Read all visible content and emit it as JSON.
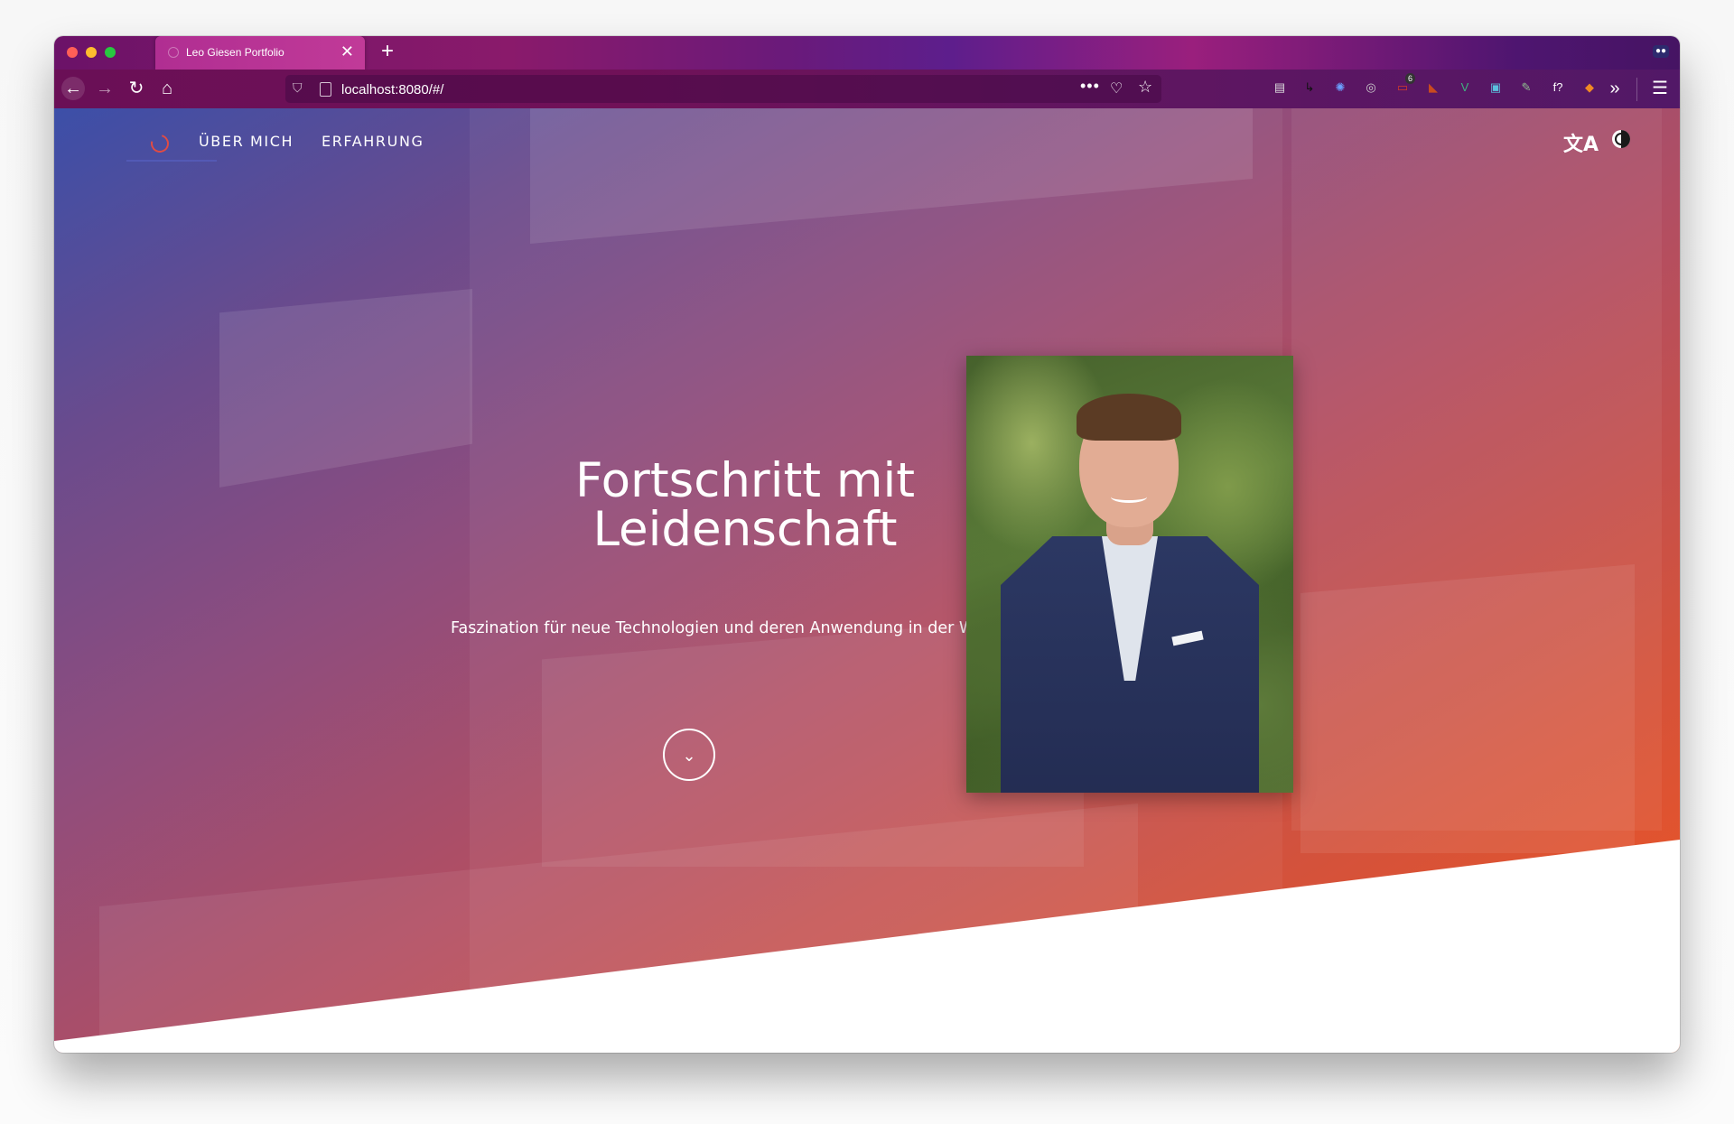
{
  "browser": {
    "tab_title": "Leo Giesen Portfolio",
    "tab_close": "✕",
    "new_tab": "+",
    "url": "localhost:8080/#/",
    "url_more": "•••",
    "nav": {
      "back": "←",
      "forward": "→",
      "reload": "↻",
      "home": "⌂"
    },
    "extensions": [
      {
        "name": "extension-1",
        "glyph": "▤",
        "color": "#dddddd"
      },
      {
        "name": "extension-2",
        "glyph": "↳",
        "color": "#111111"
      },
      {
        "name": "extension-3",
        "glyph": "✺",
        "color": "#6ba0ff"
      },
      {
        "name": "extension-4",
        "glyph": "◎",
        "color": "#cfcfcf"
      },
      {
        "name": "extension-5",
        "glyph": "▭",
        "color": "#d53a2a",
        "badge": "6"
      },
      {
        "name": "extension-6",
        "glyph": "◣",
        "color": "#c94b1f"
      },
      {
        "name": "extension-7",
        "glyph": "V",
        "color": "#3fb27f"
      },
      {
        "name": "extension-8",
        "glyph": "▣",
        "color": "#5bc0de"
      },
      {
        "name": "extension-9",
        "glyph": "✎",
        "color": "#8fbf8f"
      },
      {
        "name": "extension-10",
        "glyph": "f?",
        "color": "#ffffff"
      },
      {
        "name": "extension-11",
        "glyph": "◆",
        "color": "#f08a24"
      }
    ],
    "overflow": "»",
    "menu": "☰"
  },
  "site": {
    "nav_links": [
      "ÜBER MICH",
      "ERFAHRUNG"
    ],
    "hero_title_line1": "Fortschritt mit",
    "hero_title_line2": "Leidenschaft",
    "hero_subtitle": "Faszination für neue Technologien und deren Anwendung in der Wirtschaft",
    "scroll_icon": "⌄",
    "translate_icon": "文A"
  },
  "colors": {
    "gradient_start": "#3c4fa8",
    "gradient_mid": "#b24e62",
    "gradient_end": "#f1551f",
    "accent_logo": "#e04b44"
  }
}
